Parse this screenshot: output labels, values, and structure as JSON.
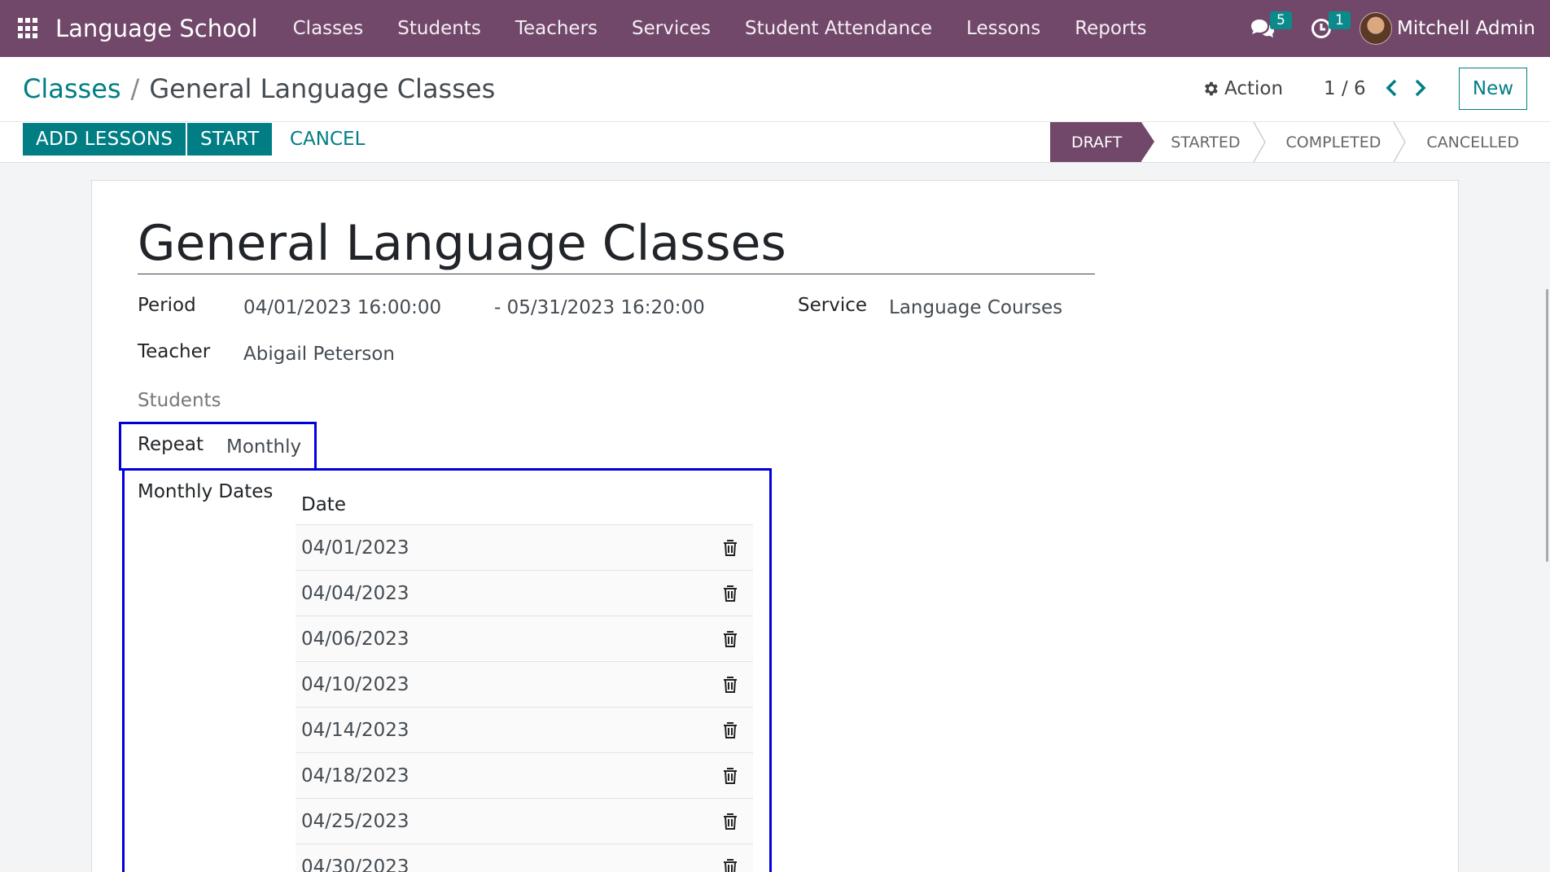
{
  "navbar": {
    "brand": "Language School",
    "menu": [
      {
        "label": "Classes"
      },
      {
        "label": "Students"
      },
      {
        "label": "Teachers"
      },
      {
        "label": "Services"
      },
      {
        "label": "Student Attendance"
      },
      {
        "label": "Lessons"
      },
      {
        "label": "Reports"
      }
    ],
    "messages_count": "5",
    "activities_count": "1",
    "user_name": "Mitchell Admin",
    "bg_color": "#71486a",
    "badge_color": "#0a8a8a"
  },
  "control_panel": {
    "breadcrumb_parent": "Classes",
    "breadcrumb_sep": "/",
    "breadcrumb_current": "General Language Classes",
    "action_label": "Action",
    "pager_value": "1 / 6",
    "new_label": "New"
  },
  "buttons": {
    "add_lessons": "ADD LESSONS",
    "start": "START",
    "cancel": "CANCEL"
  },
  "statusbar": {
    "steps": [
      {
        "label": "DRAFT",
        "active": true
      },
      {
        "label": "STARTED",
        "active": false
      },
      {
        "label": "COMPLETED",
        "active": false
      },
      {
        "label": "CANCELLED",
        "active": false
      }
    ]
  },
  "form": {
    "title": "General Language Classes",
    "period_label": "Period",
    "period_start": "04/01/2023 16:00:00",
    "period_end": "- 05/31/2023 16:20:00",
    "service_label": "Service",
    "service_value": "Language Courses",
    "teacher_label": "Teacher",
    "teacher_value": "Abigail Peterson",
    "students_label": "Students",
    "repeat_label": "Repeat",
    "repeat_value": "Monthly",
    "monthly_dates_label": "Monthly Dates",
    "dates_header": "Date",
    "dates": [
      "04/01/2023",
      "04/04/2023",
      "04/06/2023",
      "04/10/2023",
      "04/14/2023",
      "04/18/2023",
      "04/25/2023",
      "04/30/2023"
    ]
  },
  "colors": {
    "accent": "#017e84",
    "highlight": "#0000dd"
  }
}
